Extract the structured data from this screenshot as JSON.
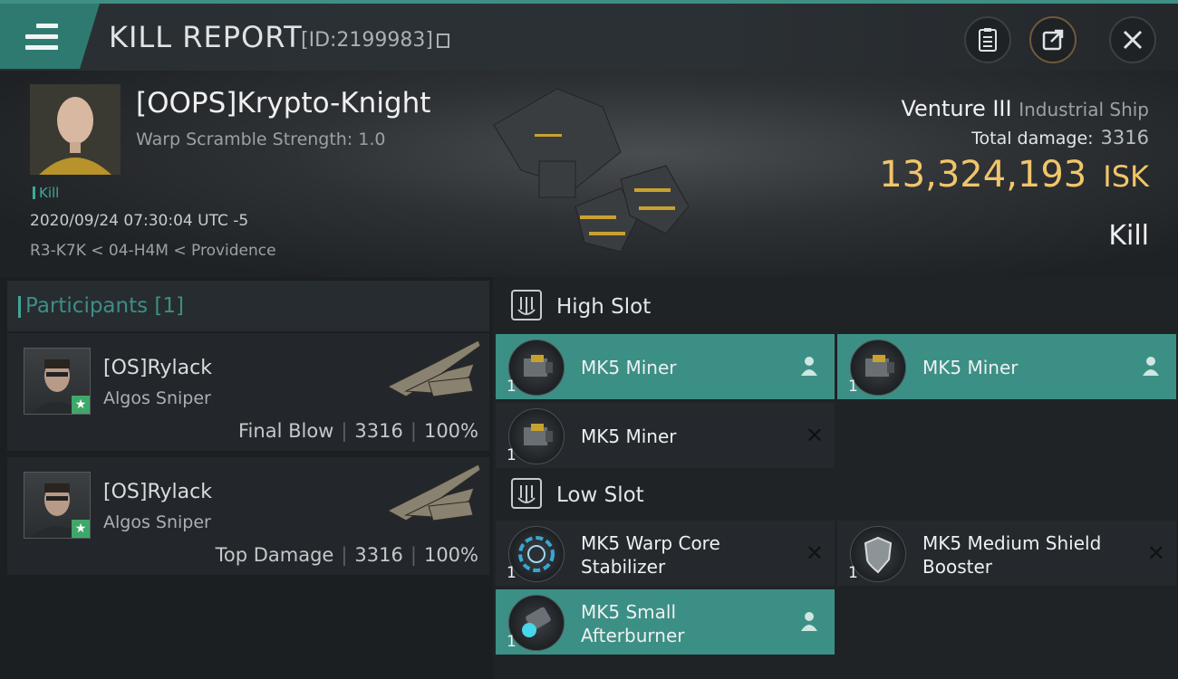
{
  "header": {
    "title": "KILL REPORT",
    "report_id": "[ID:2199983]",
    "icons": [
      "menu-icon",
      "copy-icon",
      "clipboard-icon",
      "share-icon",
      "close-icon"
    ]
  },
  "victim": {
    "name": "[OOPS]Krypto-Knight",
    "warp_scramble": "Warp Scramble Strength: 1.0",
    "kill_tag": "Kill",
    "datetime": "2020/09/24 07:30:04 UTC -5",
    "location": "R3-K7K < 04-H4M < Providence",
    "ship": "Venture III",
    "ship_class": "Industrial Ship",
    "total_damage_label": "Total damage:",
    "total_damage": "3316",
    "isk_value": "13,324,193",
    "isk_unit": "ISK",
    "result": "Kill"
  },
  "participants": {
    "label": "Participants [1]",
    "items": [
      {
        "name": "[OS]Rylack",
        "ship": "Algos Sniper",
        "role": "Final Blow",
        "damage": "3316",
        "percent": "100%"
      },
      {
        "name": "[OS]Rylack",
        "ship": "Algos Sniper",
        "role": "Top Damage",
        "damage": "3316",
        "percent": "100%"
      }
    ]
  },
  "slots": {
    "high": {
      "label": "High Slot",
      "modules": [
        {
          "name": "MK5 Miner",
          "qty": "1",
          "status": "fitted"
        },
        {
          "name": "MK5 Miner",
          "qty": "1",
          "status": "fitted"
        },
        {
          "name": "MK5 Miner",
          "qty": "1",
          "status": "destroyed"
        }
      ]
    },
    "low": {
      "label": "Low Slot",
      "modules": [
        {
          "name_line1": "MK5 Warp Core",
          "name_line2": "Stabilizer",
          "qty": "1",
          "status": "destroyed"
        },
        {
          "name_line1": "MK5 Medium Shield",
          "name_line2": "Booster",
          "qty": "1",
          "status": "destroyed"
        },
        {
          "name_line1": "MK5 Small",
          "name_line2": "Afterburner",
          "qty": "1",
          "status": "fitted"
        }
      ]
    }
  },
  "colors": {
    "accent": "#3c8f85",
    "isk": "#f1c56a",
    "star": "#3ea86a"
  }
}
